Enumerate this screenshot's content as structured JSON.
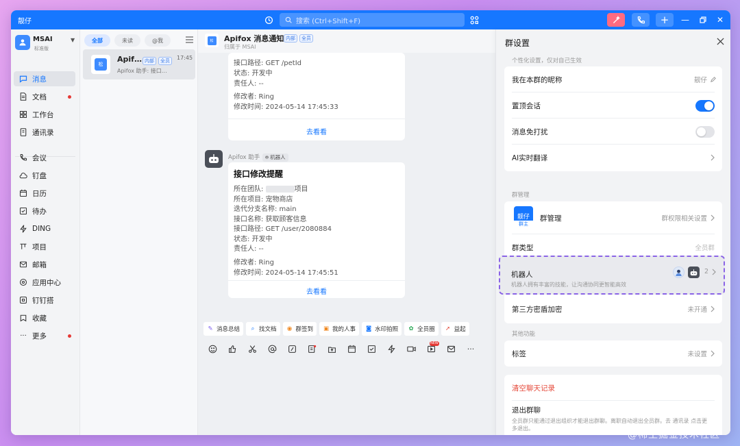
{
  "titlebar": {
    "app_name": "靓仔",
    "search_placeholder": "搜索 (Ctrl+Shift+F)",
    "accent": "#1677ff"
  },
  "sidebar": {
    "org_name": "MSAI",
    "org_plan": "标准版",
    "items": [
      {
        "label": "消息",
        "icon": "chat-icon"
      },
      {
        "label": "文档",
        "icon": "doc-icon"
      },
      {
        "label": "工作台",
        "icon": "grid-icon"
      },
      {
        "label": "通讯录",
        "icon": "contacts-icon"
      },
      {
        "label": "会议",
        "icon": "phone-icon"
      },
      {
        "label": "钉盘",
        "icon": "cloud-icon"
      },
      {
        "label": "日历",
        "icon": "calendar-icon"
      },
      {
        "label": "待办",
        "icon": "todo-icon"
      },
      {
        "label": "DING",
        "icon": "lightning-icon"
      },
      {
        "label": "项目",
        "icon": "project-icon"
      },
      {
        "label": "邮箱",
        "icon": "mail-icon"
      },
      {
        "label": "应用中心",
        "icon": "apps-icon"
      },
      {
        "label": "钉钉搭",
        "icon": "build-icon"
      },
      {
        "label": "收藏",
        "icon": "favorite-icon"
      },
      {
        "label": "更多",
        "icon": "more-icon"
      }
    ]
  },
  "conversations": {
    "filters": [
      "全部",
      "未读",
      "@我"
    ],
    "items": [
      {
        "avatar_text": "松",
        "name": "Apif…",
        "tags": [
          "内部",
          "全员"
        ],
        "time": "17:45",
        "preview": "Apifox 助手: 接口…"
      }
    ]
  },
  "chat": {
    "title": "Apifox 消息通知",
    "title_tags": [
      "内部",
      "全员"
    ],
    "subtitle": "归属于 MSAI",
    "header_avatar_text": "松",
    "card1": {
      "lines": [
        "接口路径: GET /petId",
        "状态: 开发中",
        "责任人: --",
        "修改者: Ring",
        "修改时间: 2024-05-14 17:45:33"
      ],
      "link": "去看看"
    },
    "sender": "Apifox 助手",
    "sender_tag": "机器人",
    "card2": {
      "title": "接口修改提醒",
      "team_prefix": "所在团队: ",
      "team_suffix": "项目",
      "lines": [
        "所在项目: 宠物商店",
        "迭代分支名称: main",
        "接口名称: 获取顾客信息",
        "接口路径: GET /user/2080884",
        "状态: 开发中",
        "责任人: --",
        "修改者: Ring",
        "修改时间: 2024-05-14 17:45:51"
      ],
      "link": "去看看"
    },
    "quick_actions": [
      "消息总结",
      "找文档",
      "群签到",
      "我的人事",
      "水印拍照",
      "全员圈",
      "益起"
    ],
    "toolbar_badge": "NEW"
  },
  "panel": {
    "title": "群设置",
    "personal_note": "个性化设置，仅对自己生效",
    "nickname_label": "我在本群的昵称",
    "nickname_value": "靓仔",
    "pin_label": "置顶会话",
    "pin_on": true,
    "mute_label": "消息免打扰",
    "mute_on": false,
    "ai_translate_label": "AI实时翻译",
    "manage_section": "群管理",
    "manage_avatar": "靓仔",
    "manage_owner": "群主",
    "manage_label": "群管理",
    "manage_value": "群权限相关设置",
    "type_label": "群类型",
    "type_value": "全员群",
    "robot_label": "机器人",
    "robot_desc": "机器人拥有丰富的技能，让沟通协同更智能高效",
    "robot_count": "2",
    "encrypt_label": "第三方密盾加密",
    "encrypt_value": "未开通",
    "other_section": "其他功能",
    "tag_label": "标签",
    "tag_value": "未设置",
    "clear_label": "清空聊天记录",
    "leave_label": "退出群聊",
    "leave_desc": "全员群只能通过退出组织才能退出群聊。离职自动退出全员群。去 通讯录 点击更多退出。"
  },
  "watermark": "@稀土掘金技术社区"
}
